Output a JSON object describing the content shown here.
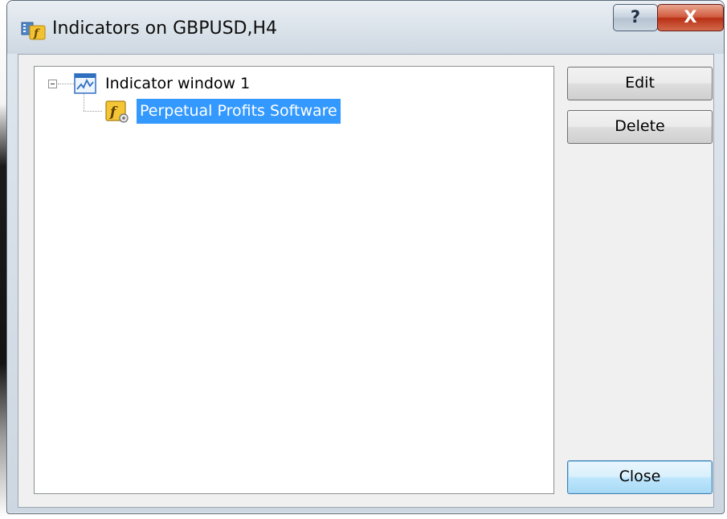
{
  "window": {
    "title": "Indicators on GBPUSD,H4",
    "help_label": "?",
    "close_label": "X"
  },
  "tree": {
    "root_label": "Indicator window 1",
    "child_label": "Perpetual Profits Software"
  },
  "buttons": {
    "edit": "Edit",
    "delete": "Delete",
    "close": "Close"
  },
  "colors": {
    "selection": "#3399ff",
    "close_button": "#c0391b",
    "default_button_border": "#3c7fb1"
  }
}
